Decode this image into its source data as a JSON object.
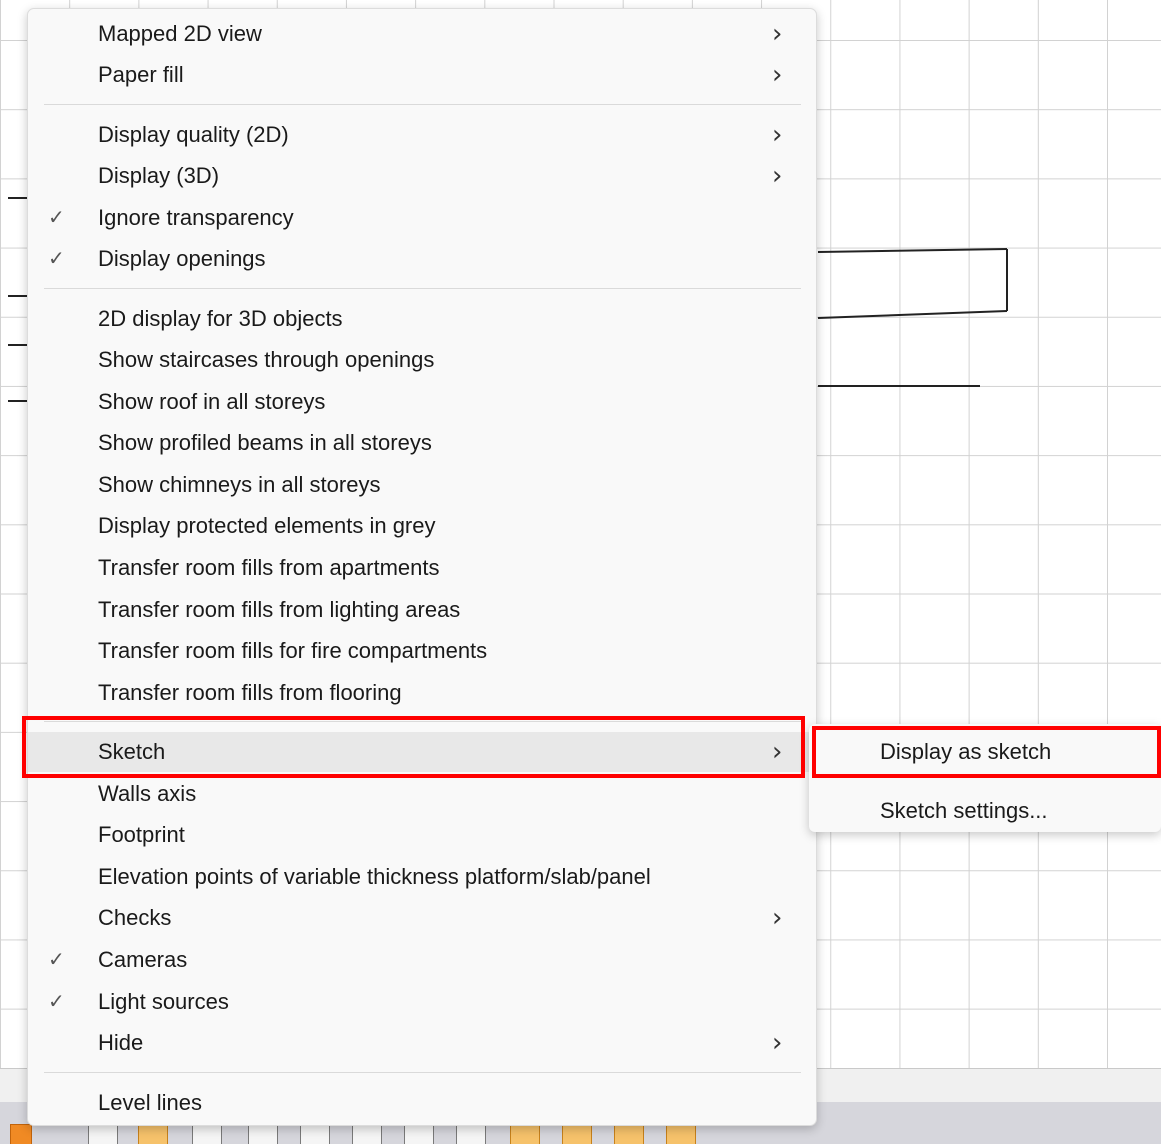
{
  "context_menu": {
    "items": [
      {
        "label": "Mapped 2D view",
        "checked": false,
        "submenu": true
      },
      {
        "label": "Paper fill",
        "checked": false,
        "submenu": true
      },
      {
        "label": "Display quality (2D)",
        "checked": false,
        "submenu": true
      },
      {
        "label": "Display (3D)",
        "checked": false,
        "submenu": true
      },
      {
        "label": "Ignore transparency",
        "checked": true,
        "submenu": false
      },
      {
        "label": "Display openings",
        "checked": true,
        "submenu": false
      },
      {
        "label": "2D display for 3D objects",
        "checked": false,
        "submenu": false
      },
      {
        "label": "Show staircases through openings",
        "checked": false,
        "submenu": false
      },
      {
        "label": "Show roof in all storeys",
        "checked": false,
        "submenu": false
      },
      {
        "label": "Show profiled beams in all storeys",
        "checked": false,
        "submenu": false
      },
      {
        "label": "Show chimneys in all storeys",
        "checked": false,
        "submenu": false
      },
      {
        "label": "Display protected elements in grey",
        "checked": false,
        "submenu": false
      },
      {
        "label": "Transfer room fills from apartments",
        "checked": false,
        "submenu": false
      },
      {
        "label": "Transfer room fills from lighting areas",
        "checked": false,
        "submenu": false
      },
      {
        "label": "Transfer room fills for fire compartments",
        "checked": false,
        "submenu": false
      },
      {
        "label": "Transfer room fills from flooring",
        "checked": false,
        "submenu": false
      },
      {
        "label": "Sketch",
        "checked": false,
        "submenu": true,
        "highlighted": true
      },
      {
        "label": "Walls axis",
        "checked": false,
        "submenu": false
      },
      {
        "label": "Footprint",
        "checked": false,
        "submenu": false
      },
      {
        "label": "Elevation points of variable thickness platform/slab/panel",
        "checked": false,
        "submenu": false
      },
      {
        "label": "Checks",
        "checked": false,
        "submenu": true
      },
      {
        "label": "Cameras",
        "checked": true,
        "submenu": false
      },
      {
        "label": "Light sources",
        "checked": true,
        "submenu": false
      },
      {
        "label": "Hide",
        "checked": false,
        "submenu": true
      },
      {
        "label": "Level lines",
        "checked": false,
        "submenu": false
      }
    ],
    "check_glyph": "✓",
    "arrow_glyph": "›"
  },
  "sketch_submenu": {
    "items": [
      {
        "label": "Display as sketch"
      },
      {
        "label": "Sketch settings..."
      }
    ]
  },
  "colors": {
    "annotation_red": "#ff0000",
    "toolbar_active": "#f6c26b",
    "toolbar_orange": "#f08a24"
  },
  "icons": [
    "status-indicator-icon",
    "toolbar-icon"
  ]
}
